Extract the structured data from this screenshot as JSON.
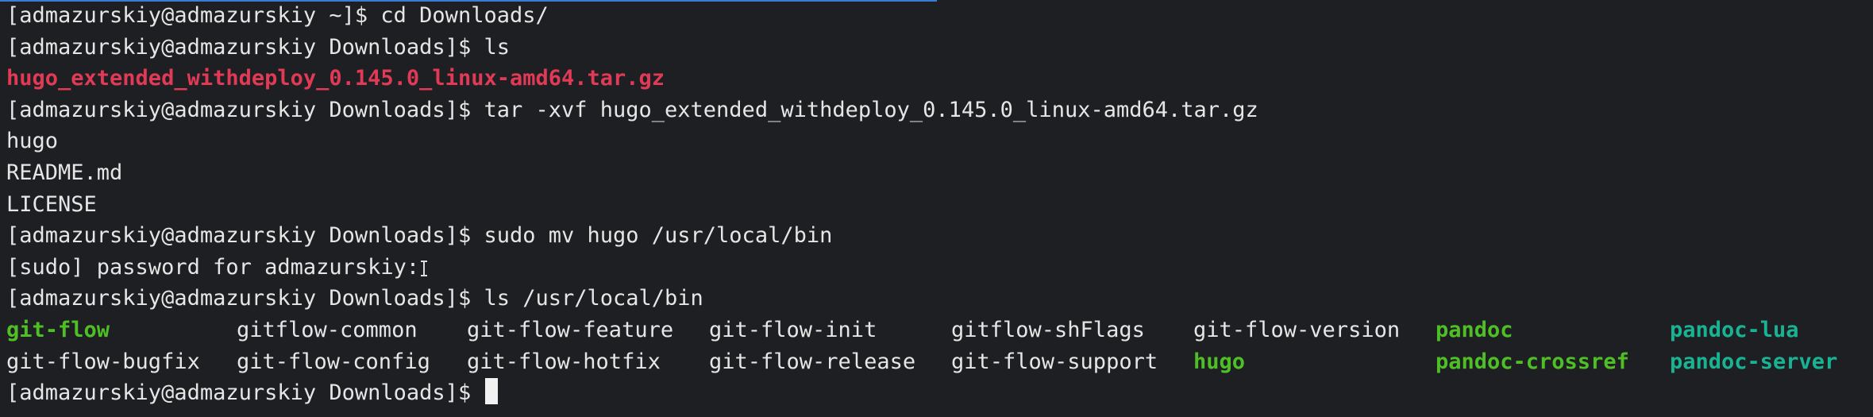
{
  "terminal": {
    "lines": [
      {
        "prompt": "[admazurskiy@admazurskiy ~]$ ",
        "cmd": "cd Downloads/"
      },
      {
        "prompt": "[admazurskiy@admazurskiy Downloads]$ ",
        "cmd": "ls"
      },
      {
        "output": "hugo_extended_withdeploy_0.145.0_linux-amd64.tar.gz"
      },
      {
        "prompt": "[admazurskiy@admazurskiy Downloads]$ ",
        "cmd": "tar -xvf hugo_extended_withdeploy_0.145.0_linux-amd64.tar.gz"
      },
      {
        "output": "hugo"
      },
      {
        "output": "README.md"
      },
      {
        "output": "LICENSE"
      },
      {
        "prompt": "[admazurskiy@admazurskiy Downloads]$ ",
        "cmd": "sudo mv hugo /usr/local/bin"
      },
      {
        "output": "[sudo] password for admazurskiy:"
      },
      {
        "prompt": "[admazurskiy@admazurskiy Downloads]$ ",
        "cmd": "ls /usr/local/bin"
      }
    ],
    "listing": {
      "row1": [
        "git-flow",
        "gitflow-common",
        "git-flow-feature",
        "git-flow-init",
        "gitflow-shFlags",
        "git-flow-version",
        "pandoc",
        "pandoc-lua"
      ],
      "row2": [
        "git-flow-bugfix",
        "git-flow-config",
        "git-flow-hotfix",
        "git-flow-release",
        "git-flow-support",
        "hugo",
        "pandoc-crossref",
        "pandoc-server"
      ]
    },
    "final_prompt": "[admazurskiy@admazurskiy Downloads]$ "
  },
  "colors": {
    "background": "#1e1f22",
    "foreground": "#e6e6e6",
    "archive": "#e03a56",
    "executable": "#4fbf26",
    "link": "#19b394"
  },
  "icons": {
    "mouse_pointer": "text-cursor-icon",
    "terminal_cursor": "block-cursor-icon"
  }
}
